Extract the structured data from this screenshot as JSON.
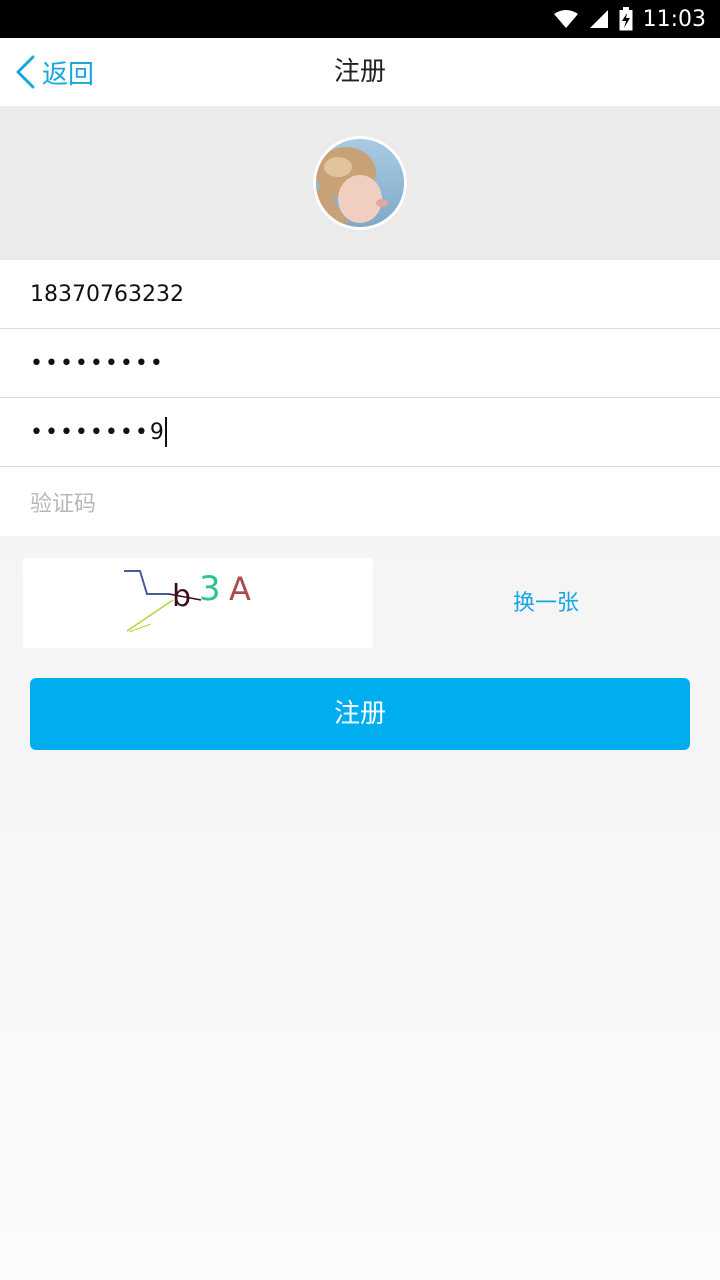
{
  "status_bar": {
    "time": "11:03"
  },
  "header": {
    "back_label": "返回",
    "title": "注册"
  },
  "form": {
    "phone_value": "18370763232",
    "password_mask": "•••••••••",
    "confirm_mask": "••••••••",
    "confirm_last_char": "9",
    "captcha_placeholder": "验证码"
  },
  "captcha": {
    "chars": [
      "b",
      "3",
      "A"
    ],
    "colors": [
      "#3a0f1f",
      "#2fc48d",
      "#b04a4a"
    ],
    "refresh_label": "换一张"
  },
  "register_button": {
    "label": "注册"
  },
  "colors": {
    "accent": "#00aeef",
    "link": "#17a6e4"
  }
}
